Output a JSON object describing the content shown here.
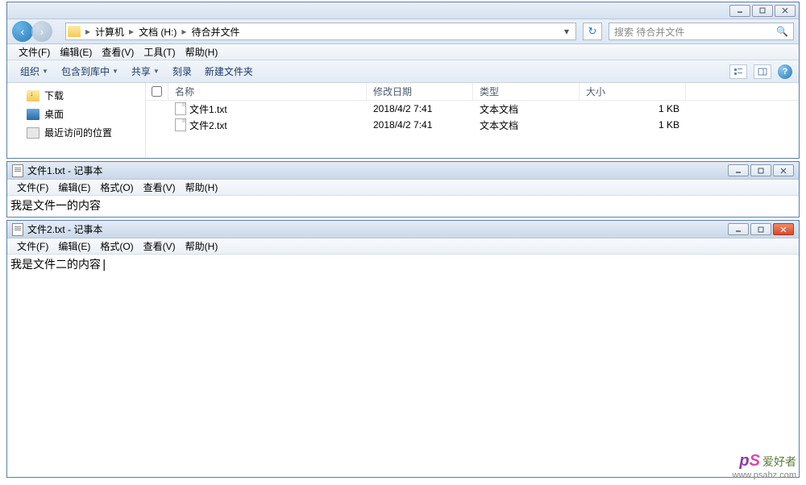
{
  "explorer": {
    "breadcrumb": [
      "计算机",
      "文档 (H:)",
      "待合并文件"
    ],
    "search_placeholder": "搜索 待合并文件",
    "menu": {
      "file": "文件(F)",
      "edit": "编辑(E)",
      "view": "查看(V)",
      "tools": "工具(T)",
      "help": "帮助(H)"
    },
    "toolbar": {
      "organize": "组织",
      "include": "包含到库中",
      "share": "共享",
      "burn": "刻录",
      "newfolder": "新建文件夹"
    },
    "sidebar": {
      "downloads": "下载",
      "desktop": "桌面",
      "recent": "最近访问的位置"
    },
    "columns": {
      "name": "名称",
      "date": "修改日期",
      "type": "类型",
      "size": "大小"
    },
    "files": [
      {
        "name": "文件1.txt",
        "date": "2018/4/2 7:41",
        "type": "文本文档",
        "size": "1 KB"
      },
      {
        "name": "文件2.txt",
        "date": "2018/4/2 7:41",
        "type": "文本文档",
        "size": "1 KB"
      }
    ]
  },
  "notepad1": {
    "title": "文件1.txt - 记事本",
    "menu": {
      "file": "文件(F)",
      "edit": "编辑(E)",
      "format": "格式(O)",
      "view": "查看(V)",
      "help": "帮助(H)"
    },
    "content": "我是文件一的内容"
  },
  "notepad2": {
    "title": "文件2.txt - 记事本",
    "menu": {
      "file": "文件(F)",
      "edit": "编辑(E)",
      "format": "格式(O)",
      "view": "查看(V)",
      "help": "帮助(H)"
    },
    "content": "我是文件二的内容"
  },
  "watermark": {
    "brand_cn": "爱好者",
    "url": "www.psahz.com"
  }
}
